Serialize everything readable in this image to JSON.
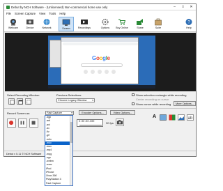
{
  "window": {
    "title": "Debut by NCH Software - (Unlicensed) Non-commercial home use only",
    "controls": [
      "–",
      "□",
      "✕"
    ]
  },
  "menu": [
    "File",
    "Screen Capture",
    "View",
    "Tools",
    "Help"
  ],
  "toolbar": {
    "buttons": [
      {
        "label": "Webcam",
        "icon": "webcam-icon"
      },
      {
        "label": "Device",
        "icon": "device-icon"
      },
      {
        "label": "Network",
        "icon": "network-icon"
      },
      {
        "label": "Screen",
        "icon": "screen-icon",
        "active": true
      },
      {
        "label": "Recordings",
        "icon": "recordings-icon"
      },
      {
        "label": "Options",
        "icon": "options-icon"
      },
      {
        "label": "Buy Online",
        "icon": "cart-icon"
      },
      {
        "label": "Share",
        "icon": "share-icon"
      },
      {
        "label": "Suite",
        "icon": "suite-icon"
      }
    ],
    "help_label": "Help"
  },
  "preview": {
    "google_text": "Google"
  },
  "selection": {
    "select_window_label": "Select Recording Window:",
    "previous_label": "Previous Selections:",
    "previous_value": "Chrome Legacy Window",
    "show_rect_label": "Show selection rectangle while recording",
    "center_label": "Center recording on cursor",
    "show_cursor_label": "Show cursor while recording",
    "more_options_label": "More Options..."
  },
  "record": {
    "record_label": "Record Screen as:",
    "format_value": "Fast Capture",
    "encoder_label": "Encoder Options...",
    "video_label": "Video Options...",
    "time": "0:00:00.000",
    "fps": "30 fps"
  },
  "status": {
    "text": "Debut v 5.11 © NCH Software"
  },
  "dropdown": {
    "items": [
      ".3gp",
      ".asf",
      ".avi",
      ".dv",
      ".flv",
      ".gif",
      ".m4v",
      ".mkv",
      ".mov",
      ".mp4",
      ".mpg",
      ".ogv",
      ".webm",
      ".wmv",
      "iPod",
      "iPhone",
      "Xbox 360",
      "PlayStation 3",
      "Fast Capture"
    ],
    "selected": ".mkv"
  },
  "colors": {
    "accent": "#0a63c9",
    "record": "#d9342b",
    "brand": "#2a8a36"
  }
}
